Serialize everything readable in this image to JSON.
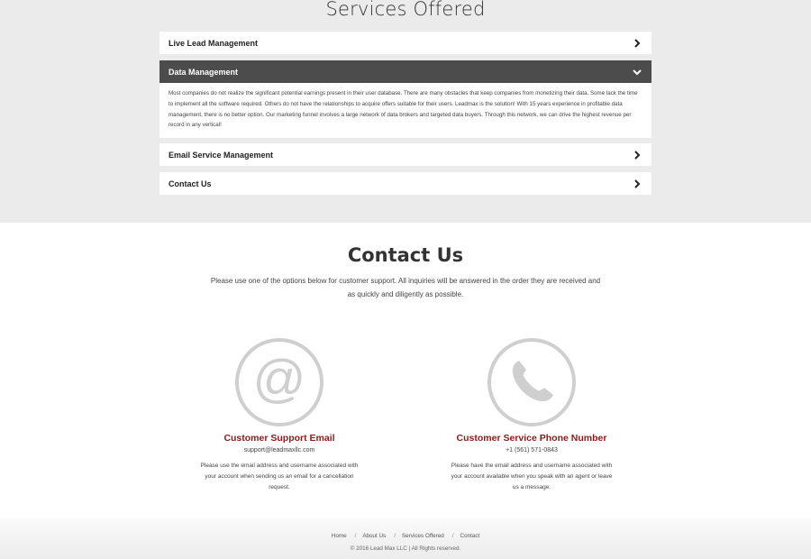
{
  "services": {
    "title": "Services Offered",
    "items": [
      {
        "label": "Live Lead Management",
        "expanded": false
      },
      {
        "label": "Data Management",
        "expanded": true,
        "body": "Most companies do not realize the significant potential earnings present in their user database. There are many obstacles that keep companies from monetizing their data. Some lack the time to implement all the software required. Others do not have the relationships to acquire offers suitable for their users. Leadmax is the solution! With 15 years experience in profitable data management, there is no better option. Our marketing funnel involves a large network of data brokers and targeted data buyers. Through this network, we can drive the highest revenue per record in any vertical!"
      },
      {
        "label": "Email Service Management",
        "expanded": false
      },
      {
        "label": "Contact Us",
        "expanded": false
      }
    ]
  },
  "contact": {
    "title": "Contact Us",
    "intro": "Please use one of the options below for customer support. All inquiries will be answered in the order they are received and as quickly and diligently as possible.",
    "email": {
      "icon": "at-sign-icon",
      "title": "Customer Support Email",
      "value": "support@leadmaxllc.com",
      "description": "Please use the email address and username associated with your account when sending us an email for a cancellation request."
    },
    "phone": {
      "icon": "phone-icon",
      "title": "Customer Service Phone Number",
      "value": "+1 (561) 571-0843",
      "description": "Please have the email address and username associated with your account available when you speak with an agent or leave us a message."
    }
  },
  "footer": {
    "nav": [
      "Home",
      "About Us",
      "Services Offered",
      "Contact"
    ],
    "copyright": "© 2016 Lead Max LLC | All Rights reserved."
  },
  "colors": {
    "accent_red": "#8b1a1a",
    "active_header": "#4c4c4c",
    "section_bg": "#ebebeb",
    "icon_gray": "#cfcfcf"
  }
}
